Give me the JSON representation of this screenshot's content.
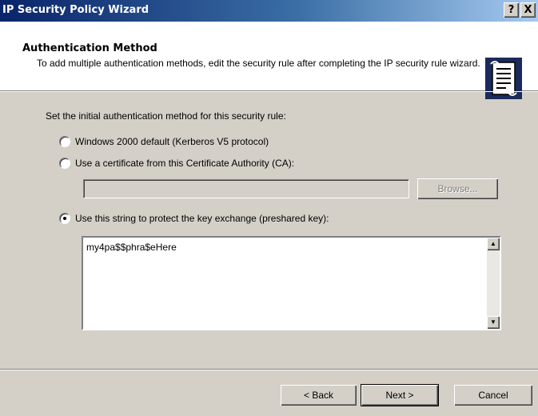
{
  "window": {
    "title": "IP Security Policy Wizard",
    "help_glyph": "?",
    "close_glyph": "X"
  },
  "header": {
    "title": "Authentication Method",
    "subtitle": "To add multiple authentication methods, edit the security rule after completing the IP security rule wizard.",
    "icon": "policy-scroll-icon"
  },
  "body": {
    "instruction": "Set the initial authentication method for this security rule:",
    "options": [
      {
        "label": "Windows 2000 default (Kerberos V5 protocol)",
        "selected": false
      },
      {
        "label": "Use a certificate from this Certificate Authority (CA):",
        "selected": false
      },
      {
        "label": "Use this string to protect the key exchange (preshared key):",
        "selected": true
      }
    ],
    "ca_value": "",
    "browse_label": "Browse...",
    "preshared_key": "my4pa$$phra$eHere"
  },
  "footer": {
    "back_label": "< Back",
    "next_label": "Next >",
    "cancel_label": "Cancel"
  }
}
